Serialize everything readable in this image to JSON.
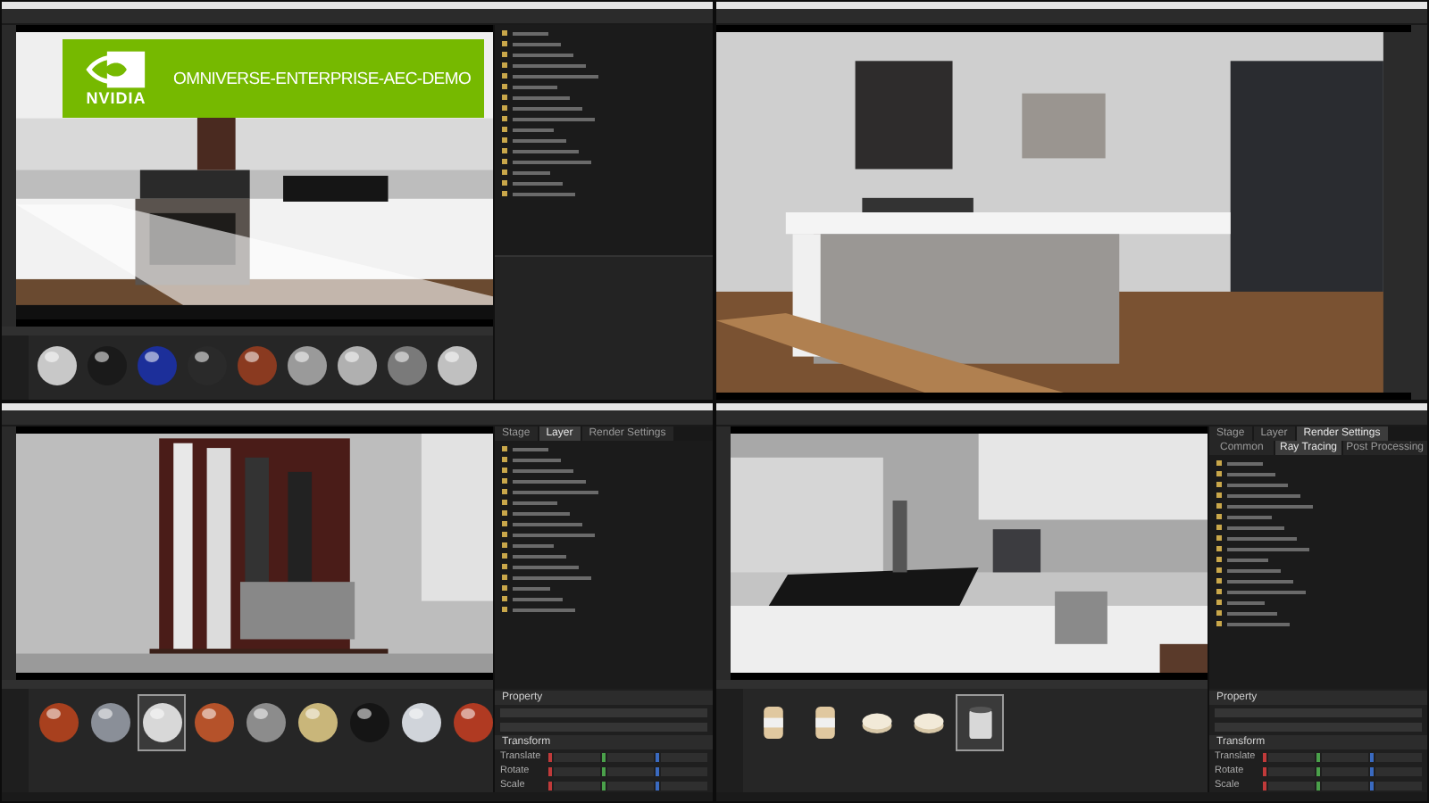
{
  "banner": {
    "logo_text": "NVIDIA",
    "title": "OMNIVERSE-ENTERPRISE-AEC-DEMO"
  },
  "windows": [
    {
      "kind": "split",
      "materials": [
        {
          "color": "#c8c8c8",
          "selected": false
        },
        {
          "color": "#1a1a1a",
          "selected": false
        },
        {
          "color": "#1c2f9a",
          "selected": false
        },
        {
          "color": "#2a2a2a",
          "selected": false
        },
        {
          "color": "#8a3a20",
          "selected": false
        },
        {
          "color": "#9a9a9a",
          "selected": false
        },
        {
          "color": "#b0b0b0",
          "selected": false
        },
        {
          "color": "#7a7a7a",
          "selected": false
        },
        {
          "color": "#c0c0c0",
          "selected": false
        }
      ]
    },
    {
      "kind": "viewport"
    },
    {
      "kind": "split",
      "panel_tabs": [
        {
          "label": "Stage",
          "selected": false
        },
        {
          "label": "Layer",
          "selected": true
        },
        {
          "label": "Render Settings",
          "selected": false
        }
      ],
      "sections": [
        {
          "label": "Property"
        },
        {
          "label": "Transform",
          "rows": [
            "Translate",
            "Rotate",
            "Scale"
          ]
        }
      ],
      "materials": [
        {
          "color": "#a8401e",
          "selected": false
        },
        {
          "color": "#8a8f98",
          "selected": false
        },
        {
          "color": "#d8d8d8",
          "selected": true
        },
        {
          "color": "#b5522a",
          "selected": false
        },
        {
          "color": "#8c8c8c",
          "selected": false
        },
        {
          "color": "#c9b67a",
          "selected": false
        },
        {
          "color": "#151515",
          "selected": false
        },
        {
          "color": "#d0d4da",
          "selected": false
        },
        {
          "color": "#b03a22",
          "selected": false
        }
      ]
    },
    {
      "kind": "split",
      "panel_tabs": [
        {
          "label": "Stage",
          "selected": false
        },
        {
          "label": "Layer",
          "selected": false
        },
        {
          "label": "Render Settings",
          "selected": true
        }
      ],
      "sub_tabs": [
        {
          "label": "Common",
          "selected": false
        },
        {
          "label": "Ray Tracing",
          "selected": true
        },
        {
          "label": "Post Processing",
          "selected": false
        }
      ],
      "sections": [
        {
          "label": "Property"
        },
        {
          "label": "Transform",
          "rows": [
            "Translate",
            "Rotate",
            "Scale"
          ]
        }
      ],
      "assets": [
        {
          "kind": "jar",
          "selected": false
        },
        {
          "kind": "jar",
          "selected": false
        },
        {
          "kind": "wheel",
          "selected": false
        },
        {
          "kind": "wheel",
          "selected": false
        },
        {
          "kind": "pot",
          "selected": true
        }
      ]
    }
  ]
}
